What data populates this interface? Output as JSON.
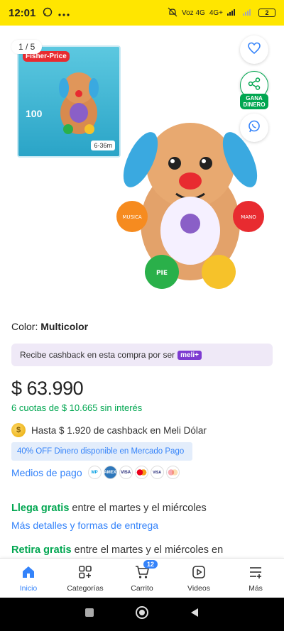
{
  "status": {
    "time": "12:01",
    "carrier": "Voz 4G",
    "network": "4G+",
    "battery": "2"
  },
  "gallery": {
    "counter": "1 / 5",
    "thumb_brand": "Fisher-Price",
    "thumb_big": "100",
    "thumb_age": "6-36m",
    "ganar_label_1": "GANA",
    "ganar_label_2": "DINERO",
    "toy_left_paw": "MUSICA",
    "toy_right_paw": "MANO",
    "toy_foot": "PIE"
  },
  "product": {
    "color_label": "Color:",
    "color_value": "Multicolor",
    "cashback_banner": "Recibe cashback en esta compra por ser",
    "meli_badge": "meli+",
    "price": "$ 63.990",
    "installments": "6 cuotas de $ 10.665 sin interés",
    "cashback_text": "Hasta $ 1.920 de cashback en Meli Dólar",
    "off_banner": "40% OFF Dinero disponible en Mercado Pago",
    "payment_label": "Medios de pago",
    "llega_bold": "Llega gratis",
    "llega_rest": " entre el martes y el miércoles",
    "mas_detalles": "Más detalles y formas de entrega",
    "retira_bold": "Retira gratis",
    "retira_rest": " entre el martes y el miércoles en"
  },
  "payment_cards": [
    "MP",
    "AMEX",
    "VISA",
    "MC",
    "VISA",
    "MC"
  ],
  "nav": {
    "inicio": "Inicio",
    "categorias": "Categorías",
    "carrito": "Carrito",
    "carrito_badge": "12",
    "videos": "Videos",
    "mas": "Más"
  },
  "colors": {
    "accent": "#3483fa",
    "green": "#00a650",
    "statusbar": "#ffe600"
  }
}
